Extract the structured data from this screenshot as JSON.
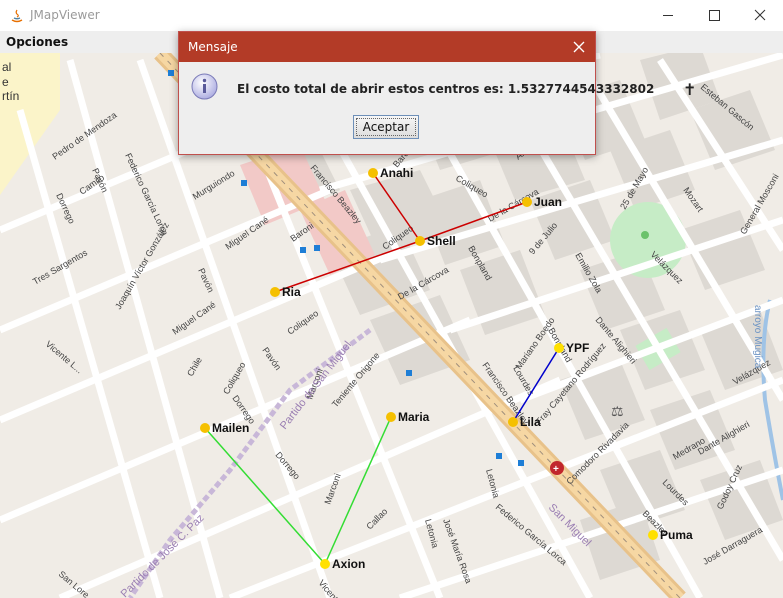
{
  "window": {
    "title": "JMapViewer",
    "controls": [
      "minimize-icon",
      "maximize-icon",
      "close-icon"
    ]
  },
  "menu": {
    "items": [
      "Opciones"
    ]
  },
  "map": {
    "streets": {
      "mendoza": "Pedro de Mendoza",
      "pavon1": "Pavón",
      "camilo": "Camilo",
      "garcia_lorca": "Federico García Lorca",
      "murguiondo": "Murguiondo",
      "dorrego1": "Dorrego",
      "sargentos": "Tres Sargentos",
      "victor_gonzalez": "Joaquín Víctor González",
      "pavon2": "Pavón",
      "miguel_cane1": "Miguel Cané",
      "miguel_cane2": "Miguel Cané",
      "beazley1": "Francisco Beazley",
      "baroni1": "Baroni",
      "baroni2": "Baroni",
      "coliqueo1": "Coliqueo",
      "coliqueo2": "Coliqueo",
      "coliqueo3": "Coliqueo",
      "coliqueo4": "Coliqueo",
      "alice": "Alice",
      "carcova1": "De la Cárcova",
      "carcova2": "De la Cárcova",
      "bonpland": "Bonpland",
      "julio": "9 de Julio",
      "emilio_zola": "Emilio Zola",
      "velazquez1": "Velázquez",
      "velazquez2": "Velázquez",
      "mayo": "25 de Mayo",
      "mosconi": "General Mosconi",
      "mozart": "Mozart",
      "gascon": "Esteban Gascón",
      "dante1": "Dante Alighieri",
      "dante2": "Dante Alighieri",
      "boedo": "Mariano Boedo",
      "bonpland2": "Bonpland",
      "lourdes1": "Lourdes",
      "rodriguez": "Fray Cayetano Rodríguez",
      "beazley2": "Francisco Beazley",
      "beazley3": "Beazley",
      "comodoro": "Comodoro Rivadavia",
      "letonia1": "Letonia",
      "letonia2": "Letonia",
      "cruz": "Godoy Cruz",
      "darraguera": "José Darraguera",
      "medrano": "Medrano",
      "lourdes2": "Lourdes",
      "pavon3": "Pavón",
      "chile": "Chile",
      "vicente1": "Vicente L...",
      "origone": "Teniente Origone",
      "marconi1": "Marconi",
      "marconi2": "Marconi",
      "dorrego2": "Dorrego",
      "dorrego3": "Dorrego",
      "callao": "Callao",
      "jose_maria_rosa": "José María Rosa",
      "garcia_lorca2": "Federico García Lorca",
      "san_lorenzo": "San Lore...",
      "vicente2": "Vicente..."
    },
    "districts": {
      "san_miguel1": "Partido de San Miguel",
      "san_miguel2": "San Miguel",
      "paz": "Partido de José C. Paz"
    },
    "waterway": "arroyo Mugica",
    "corner_partial": [
      "al",
      "e",
      "rtín"
    ],
    "markers": [
      {
        "name": "Anahi",
        "color": "#f5c000"
      },
      {
        "name": "Juan",
        "color": "#f5c000"
      },
      {
        "name": "Shell",
        "color": "#f5c000"
      },
      {
        "name": "Ria",
        "color": "#f5c000"
      },
      {
        "name": "YPF",
        "color": "#ffe000"
      },
      {
        "name": "Lila",
        "color": "#f5c000"
      },
      {
        "name": "Maria",
        "color": "#f5c000"
      },
      {
        "name": "Mailen",
        "color": "#f5c000"
      },
      {
        "name": "Axion",
        "color": "#ffe000"
      },
      {
        "name": "Puma",
        "color": "#ffe000"
      }
    ],
    "lines": {
      "red": "#cc0000",
      "blue": "#0000cc",
      "green": "#33dd33"
    }
  },
  "dialog": {
    "title": "Mensaje",
    "message": "El costo total de abrir estos centros es: 1.5327744543332802",
    "button": "Aceptar",
    "icon": "info-icon",
    "title_bar_color": "#b33b27"
  }
}
